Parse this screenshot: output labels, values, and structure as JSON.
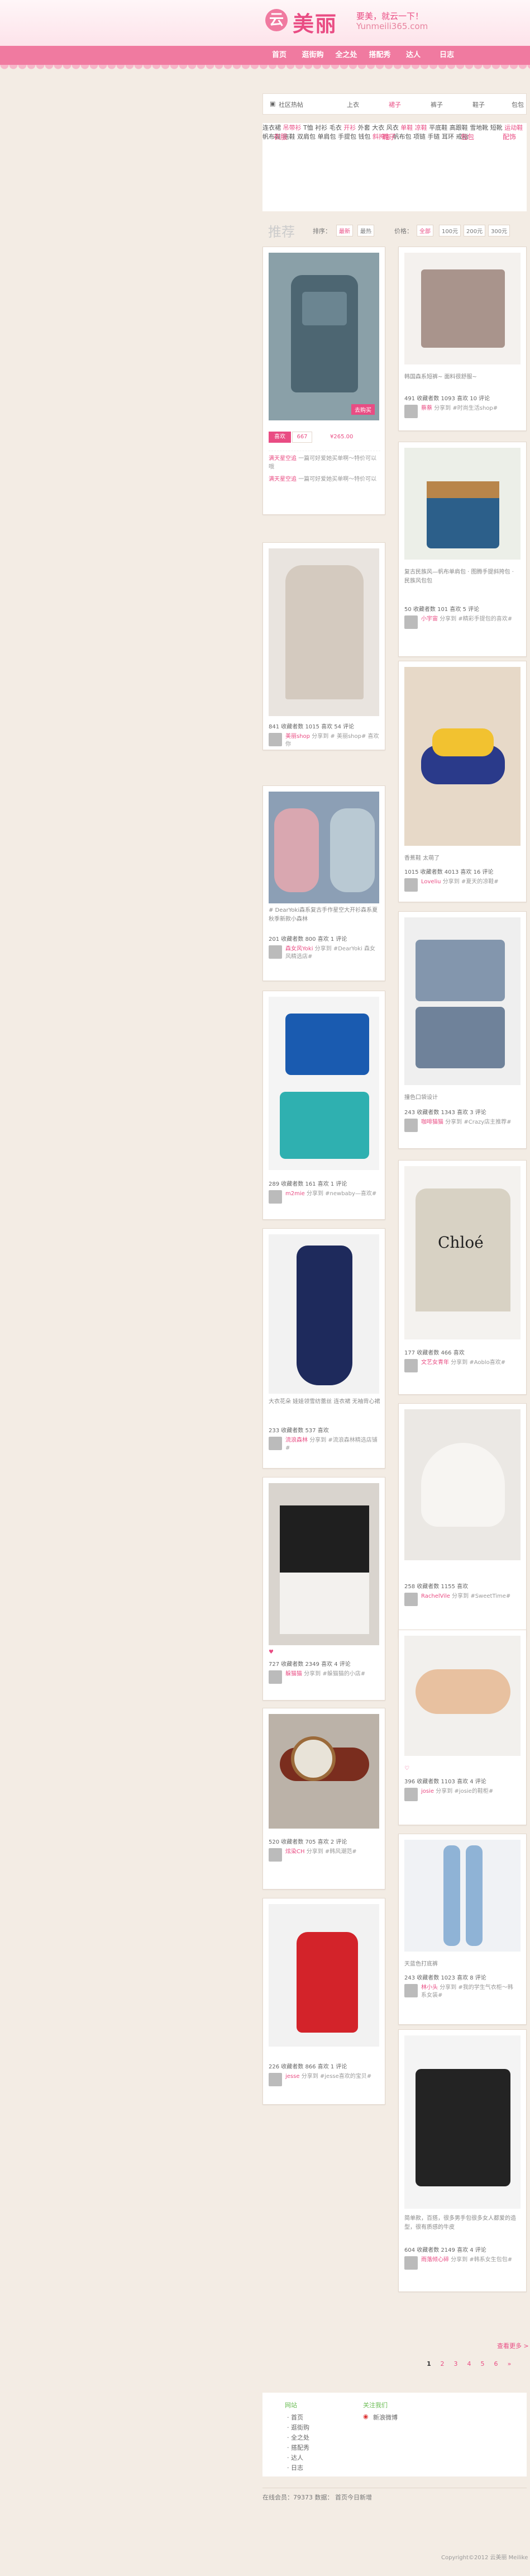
{
  "header": {
    "logo_mark": "云",
    "logo_text": "美丽",
    "slogan": "要美，就云一下！",
    "domain": "Yunmeili365.com"
  },
  "nav": {
    "items": [
      "首页",
      "逛街购",
      "全之处",
      "搭配秀",
      "达人",
      "日志"
    ]
  },
  "subnav": {
    "items": [
      "社区热帖",
      "上衣",
      "裙子",
      "裤子",
      "鞋子",
      "包包"
    ]
  },
  "categories": {
    "columns": [
      {
        "head": "衣服",
        "cells": [
          "连衣裙",
          "吊带衫",
          "T恤",
          "衬衫",
          "毛衣",
          "开衫",
          "外套",
          "大衣",
          "风衣"
        ]
      },
      {
        "head": "鞋子",
        "cells": [
          "单鞋",
          "凉鞋",
          "平底鞋",
          "高跟鞋",
          "雪地靴",
          "短靴",
          "运动鞋",
          "帆布鞋",
          "拖鞋"
        ]
      },
      {
        "head": "包包",
        "cells": [
          "双肩包",
          "单肩包",
          "手提包",
          "钱包",
          "斜挎包",
          "帆布包",
          "化妆包",
          "旅行包",
          "信封包"
        ]
      },
      {
        "head": "配饰",
        "cells": [
          "项链",
          "手链",
          "耳环",
          "戒指",
          "发饰",
          "帽子",
          "围巾",
          "手表",
          "腰带"
        ]
      }
    ]
  },
  "filter": {
    "label": "推荐",
    "sort_label": "排序：",
    "sort_options": [
      "最新",
      "最热"
    ],
    "price_label": "价格：",
    "price_options": [
      "全部",
      "100元",
      "200元",
      "300元"
    ]
  },
  "cards": [
    {
      "desc": "",
      "stats": "",
      "user": "",
      "note": "",
      "like_label": "喜欢",
      "like_count": "667",
      "buy_label": "去购买",
      "price": "¥265.00",
      "comments": [
        {
          "name": "满天星空追",
          "text": "一篇可好爱她买单啊～特价可以哦"
        },
        {
          "name": "满天星空追",
          "text": "一篇可好爱她买单啊～特价可以"
        }
      ]
    },
    {
      "desc": "",
      "stats": "841 收藏者数   1015 喜欢   54 评论",
      "user": "美丽shop",
      "note": "分享到 # 美丽shop# 喜欢你"
    },
    {
      "desc": "# DearYoki森系复古手作星空大开衫森系夏秋季新款小森林",
      "stats": "201 收藏者数   800 喜欢   1 评论",
      "user": "森女风Yoki",
      "note": "分享到 #DearYoki 森女风精选店#"
    },
    {
      "desc": "",
      "stats": "289 收藏者数   161 喜欢   1 评论",
      "user": "m2mie",
      "note": "分享到 #newbaby—喜欢#"
    },
    {
      "desc": "大衣花朵 娃娃领雪纺蕾丝 连衣裙 无袖背心裙",
      "stats": "233 收藏者数   537 喜欢",
      "user": "流浪森林",
      "note": "分享到 #流浪森林精选店铺#"
    },
    {
      "desc": "♥",
      "stats": "727 收藏者数   2349 喜欢   4 评论",
      "user": "躲猫猫",
      "note": "分享到 #躲猫猫的小店#"
    },
    {
      "desc": "",
      "stats": "520 收藏者数   705 喜欢   2 评论",
      "user": "炫染CH",
      "note": "分享到 #韩风潮范#"
    },
    {
      "desc": "",
      "stats": "226 收藏者数   866 喜欢   1 评论",
      "user": "jesse",
      "note": "分享到 #jesse喜欢的宝贝#"
    },
    {
      "desc": "韩国森系短裤~ 面料很舒服~",
      "stats": "491 收藏者数   1093 喜欢   10 评论",
      "user": "蔡蔡",
      "note": "分享到 #时尚生活shop#"
    },
    {
      "desc": "复古民族风—帆布单肩包 · 图腾手提斜挎包 · 民族风包包",
      "stats": "50 收藏者数   101 喜欢   5 评论",
      "user": "小宇宙",
      "note": "分享到 #精彩手提包的喜欢#"
    },
    {
      "desc": "香蕉鞋 太萌了",
      "stats": "1015 收藏者数   4013 喜欢   16 评论",
      "user": "Loveliu",
      "note": "分享到 #夏天的凉鞋#"
    },
    {
      "desc": "撞色口袋设计",
      "stats": "243 收藏者数   1343 喜欢   3 评论",
      "user": "咖啡猫猫",
      "note": "分享到 #Crazy店主推荐#"
    },
    {
      "desc": "",
      "stats": "177 收藏者数   466 喜欢",
      "user": "文艺女青年",
      "note": "分享到 #Aoblo喜欢#"
    },
    {
      "desc": "",
      "stats": "258 收藏者数   1155 喜欢",
      "user": "RachelVile",
      "note": "分享到 #SweetTime#"
    },
    {
      "desc": "♡",
      "stats": "396 收藏者数   1103 喜欢   4 评论",
      "user": "josie",
      "note": "分享到 #josie的鞋柜#"
    },
    {
      "desc": "天蓝色打底裤",
      "stats": "243 收藏者数   1023 喜欢   8 评论",
      "user": "林小头",
      "note": "分享到 #我的学生气衣柜～韩系女装#"
    },
    {
      "desc": "简单款，百搭，很多男手包很多女人都爱的造型，很有质感的牛皮",
      "stats": "604 收藏者数   2149 喜欢   4 评论",
      "user": "雨落倾心碎",
      "note": "分享到 #韩系女生包包#"
    }
  ],
  "more_link": "查看更多 >",
  "pager": [
    "1",
    "2",
    "3",
    "4",
    "5",
    "6",
    "»"
  ],
  "footer": {
    "col1_head": "网站",
    "col1_links": [
      "· 首页",
      "· 逛街购",
      "· 全之处",
      "· 搭配秀",
      "· 达人",
      "· 日志"
    ],
    "col2_head": "关注我们",
    "col2_links": [
      "新浪微博"
    ],
    "stats": "在线会员：79373 数据：  首页今日新增"
  },
  "copyright": "Copyright©2012 云美丽 Meilike"
}
